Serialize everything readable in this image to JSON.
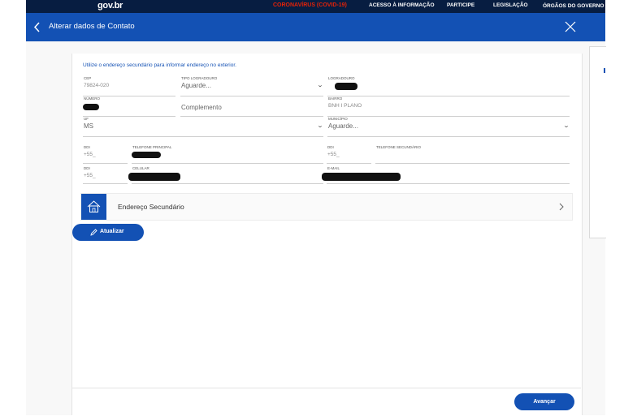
{
  "topbar": {
    "logo": "gov.br",
    "nav": [
      {
        "label": "CORONAVÍRUS (COVID-19)"
      },
      {
        "label": "ACESSO À INFORMAÇÃO"
      },
      {
        "label": "PARTICIPE"
      },
      {
        "label": "LEGISLAÇÃO"
      },
      {
        "label": "ÓRGÃOS DO GOVERNO"
      }
    ]
  },
  "header": {
    "title": "Alterar dados de Contato"
  },
  "form": {
    "info": "Utilize o endereço secundário para informar endereço no exterior.",
    "cep": {
      "label": "CEP",
      "value": "79824-020"
    },
    "tipo_logradouro": {
      "label": "TIPO LOGRADOURO",
      "value": "Aguarde..."
    },
    "logradouro": {
      "label": "LOGRADOURO"
    },
    "numero": {
      "label": "NÚMERO"
    },
    "complemento": {
      "placeholder": "Complemento"
    },
    "bairro": {
      "label": "BAIRRO",
      "value": "BNH I PLANO"
    },
    "uf": {
      "label": "UF",
      "value": "MS"
    },
    "municipio": {
      "label": "MUNICÍPIO",
      "value": "Aguarde..."
    },
    "ddi1": {
      "label": "DDI",
      "value": "+55_"
    },
    "tel_principal": {
      "label": "TELEFONE PRINCIPAL"
    },
    "ddi2": {
      "label": "DDI",
      "value": "+55_"
    },
    "tel_secundario": {
      "label": "TELEFONE SECUNDÁRIO"
    },
    "ddi3": {
      "label": "DDI",
      "value": "+55_"
    },
    "celular": {
      "label": "CELULAR"
    },
    "email": {
      "label": "E-MAIL"
    }
  },
  "secondary_address": {
    "label": "Endereço Secundário"
  },
  "buttons": {
    "update": "Atualizar",
    "next": "Avançar"
  }
}
